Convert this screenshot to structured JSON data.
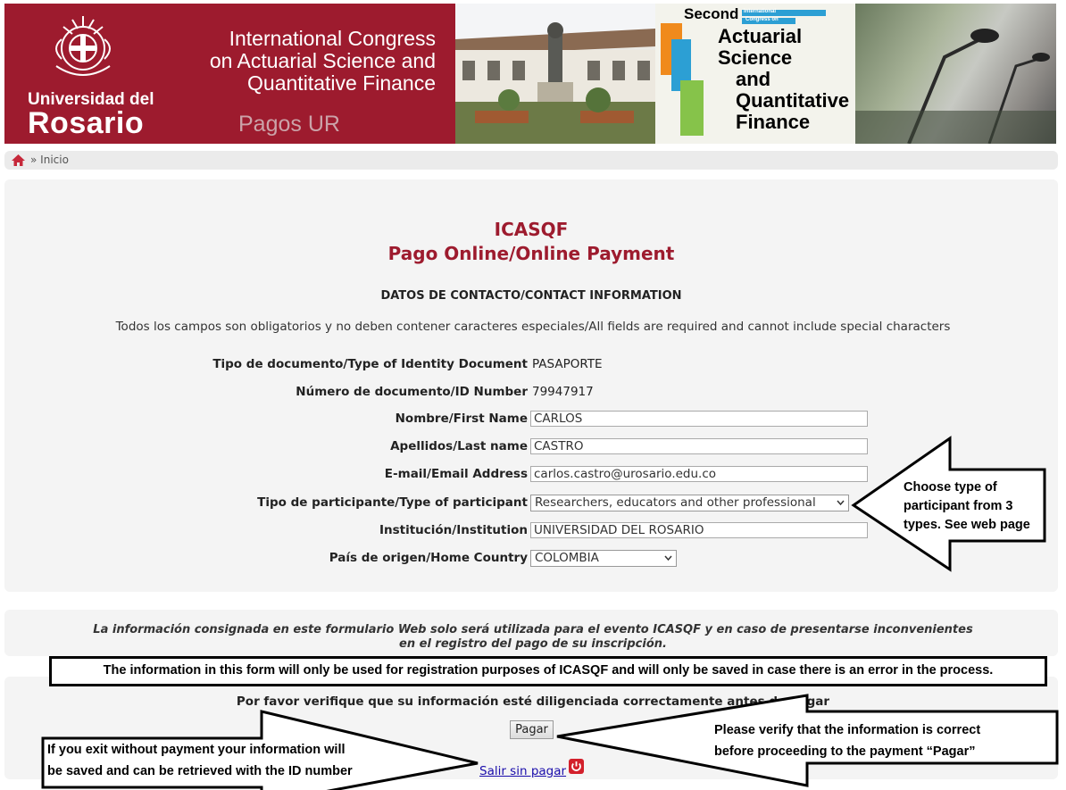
{
  "banner": {
    "university_line1": "Universidad del",
    "university_line2": "Rosario",
    "congress_line1": "International Congress",
    "congress_line2": "on Actuarial Science and",
    "congress_line3": "Quantitative Finance",
    "pagos": "Pagos UR",
    "logo_second": "Second",
    "logo_international": "International",
    "logo_congress_on": "Congress on",
    "logo_line1": "Actuarial",
    "logo_line2": "Science",
    "logo_line3": "and",
    "logo_line4": "Quantitative",
    "logo_line5": "Finance"
  },
  "breadcrumb": {
    "home_icon": "home-icon",
    "separator": "»",
    "label": "Inicio"
  },
  "header": {
    "title": "ICASQF",
    "subtitle": "Pago Online/Online Payment",
    "section": "DATOS DE CONTACTO/CONTACT INFORMATION",
    "notice": "Todos los campos son obligatorios y no deben contener caracteres especiales/All fields are required and cannot include special characters"
  },
  "form": {
    "doc_type": {
      "label": "Tipo de documento/Type of Identity Document",
      "value": "PASAPORTE"
    },
    "doc_number": {
      "label": "Número de documento/ID Number",
      "value": "79947917"
    },
    "first_name": {
      "label": "Nombre/First Name",
      "value": "CARLOS"
    },
    "last_name": {
      "label": "Apellidos/Last name",
      "value": "CASTRO"
    },
    "email": {
      "label": "E-mail/Email Address",
      "value": "carlos.castro@urosario.edu.co"
    },
    "participant_type": {
      "label": "Tipo de participante/Type of participant",
      "value": "Researchers, educators and other professional"
    },
    "institution": {
      "label": "Institución/Institution",
      "value": "UNIVERSIDAD DEL ROSARIO"
    },
    "country": {
      "label": "País de origen/Home Country",
      "value": "COLOMBIA"
    }
  },
  "privacy": {
    "spanish_line1": "La información consignada en este formulario Web solo será utilizada para el evento ICASQF y en caso de presentarse inconvenientes",
    "spanish_line2": "en el registro del pago de su inscripción.",
    "english": "The information in this form will only be used for registration purposes of ICASQF and will only be saved in case there is an error in the process."
  },
  "actions": {
    "verify": "Por favor verifique que su información esté diligenciada correctamente antes de pagar",
    "pay_button": "Pagar",
    "exit_link": "Salir sin pagar"
  },
  "annotations": {
    "participant_line1": "Choose type of",
    "participant_line2": "participant from 3",
    "participant_line3": "types. See web page",
    "pay_line1": "Please verify that the information is correct",
    "pay_line2": "before proceeding to the payment “Pagar”",
    "exit_line1": "If you exit without payment your information will",
    "exit_line2": "be saved and can be retrieved with the ID number"
  },
  "colors": {
    "brand": "#9d1b2e",
    "panel": "#f4f4f4",
    "link": "#1a0dab"
  }
}
